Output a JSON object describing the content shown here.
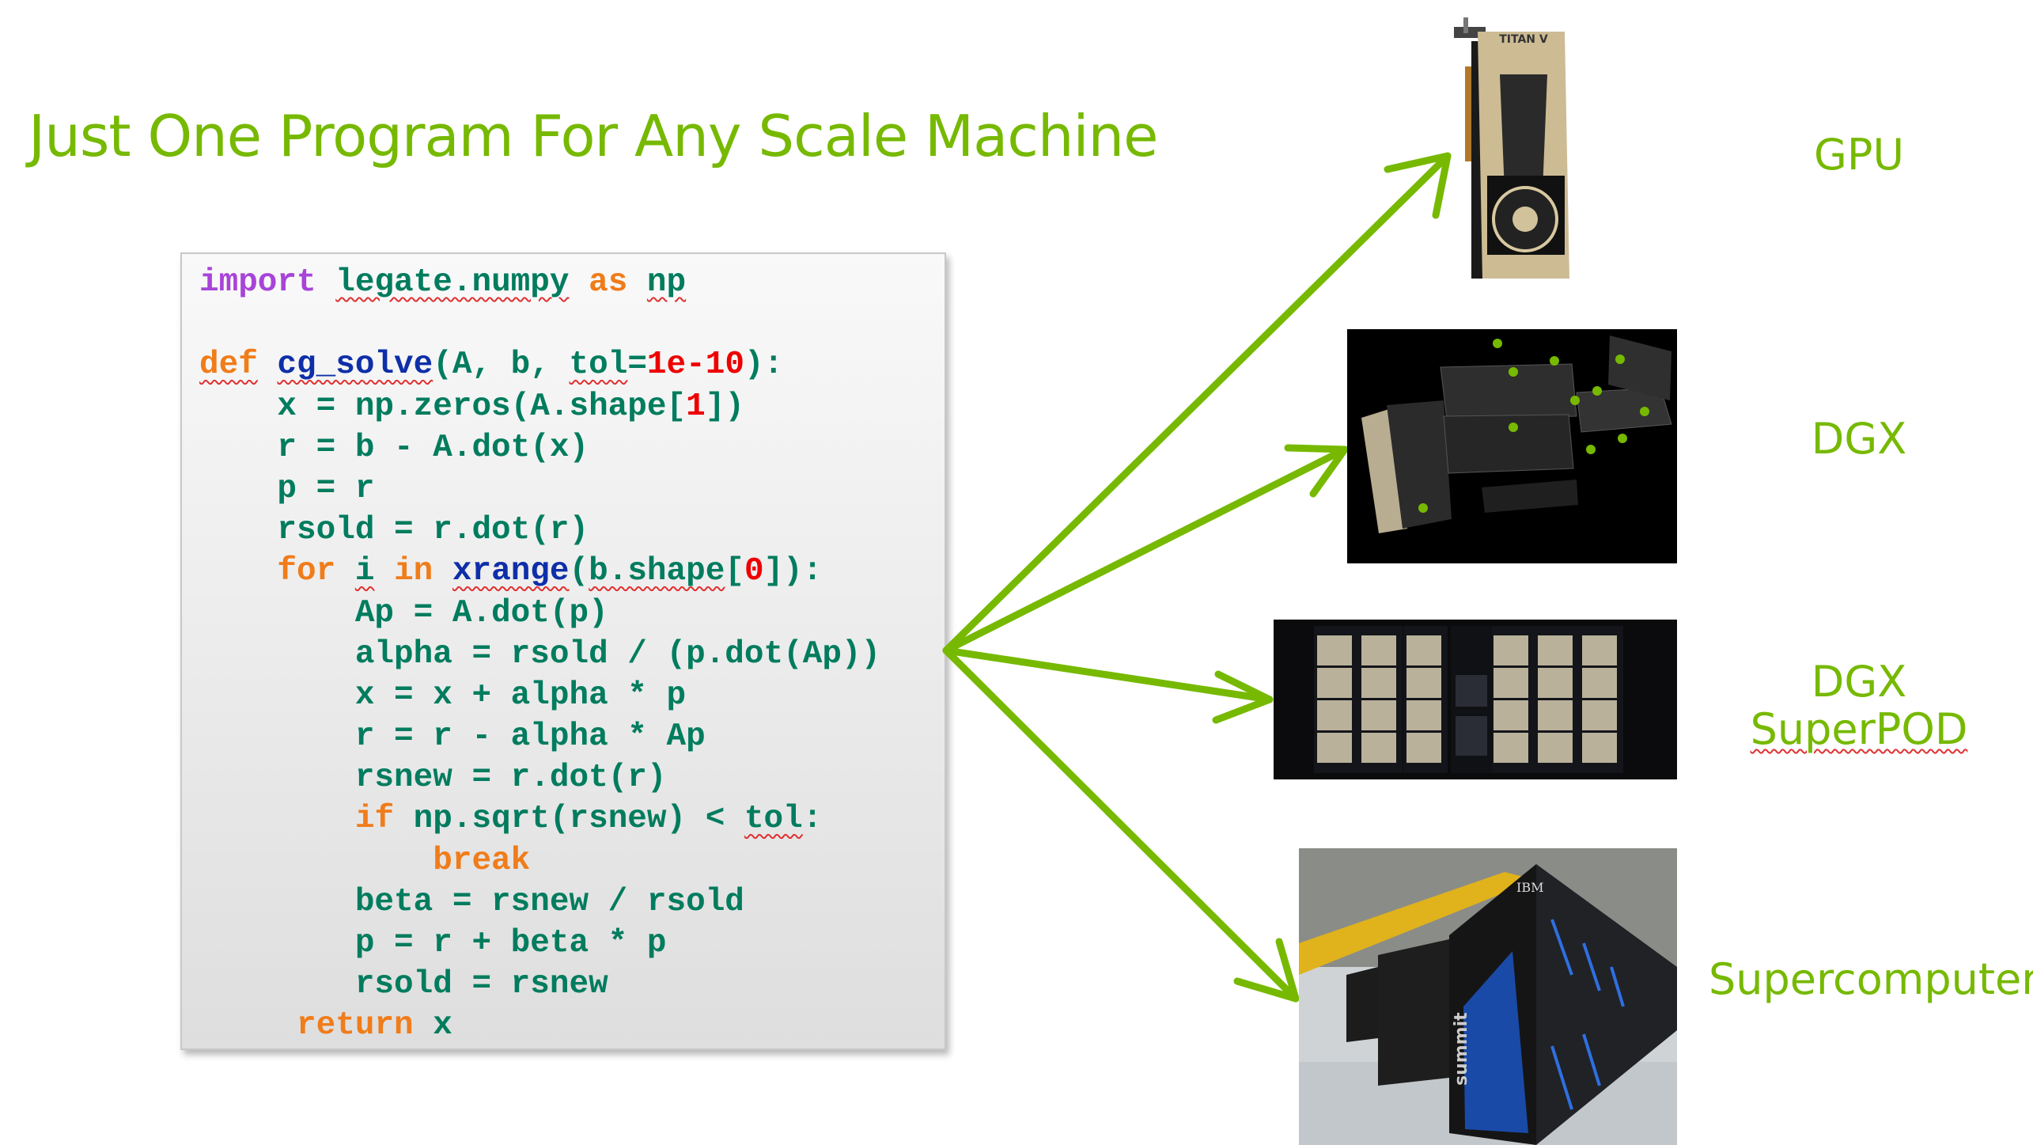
{
  "slide": {
    "title": "Just One Program For Any Scale Machine",
    "accent_color": "#76b900"
  },
  "code": {
    "language": "python",
    "lines": [
      [
        {
          "t": "import",
          "c": "kw-purple"
        },
        {
          "t": " "
        },
        {
          "t": "legate.numpy",
          "s": true
        },
        {
          "t": " "
        },
        {
          "t": "as",
          "c": "kw-orange"
        },
        {
          "t": " "
        },
        {
          "t": "np",
          "s": true
        }
      ],
      [],
      [
        {
          "t": "def",
          "c": "kw-orange",
          "s": true
        },
        {
          "t": " "
        },
        {
          "t": "cg_solve",
          "c": "fn-blue",
          "s": true
        },
        {
          "t": "(A, b, "
        },
        {
          "t": "tol",
          "s": true
        },
        {
          "t": "="
        },
        {
          "t": "1e-10",
          "c": "num-red"
        },
        {
          "t": "):"
        }
      ],
      [
        {
          "t": "    x = np.zeros(A.shape["
        },
        {
          "t": "1",
          "c": "num-red"
        },
        {
          "t": "])"
        }
      ],
      [
        {
          "t": "    r = b - A.dot(x)"
        }
      ],
      [
        {
          "t": "    p = r"
        }
      ],
      [
        {
          "t": "    rsold = r.dot(r)"
        }
      ],
      [
        {
          "t": "    "
        },
        {
          "t": "for",
          "c": "kw-orange"
        },
        {
          "t": " "
        },
        {
          "t": "i",
          "s": true
        },
        {
          "t": " "
        },
        {
          "t": "in",
          "c": "kw-orange"
        },
        {
          "t": " "
        },
        {
          "t": "xrange",
          "c": "fn-blue",
          "s": true
        },
        {
          "t": "("
        },
        {
          "t": "b.shape",
          "s": true
        },
        {
          "t": "["
        },
        {
          "t": "0",
          "c": "num-red"
        },
        {
          "t": "]):"
        }
      ],
      [
        {
          "t": "        Ap = A.dot(p)"
        }
      ],
      [
        {
          "t": "        alpha = rsold / (p.dot(Ap))"
        }
      ],
      [
        {
          "t": "        x = x + alpha * p"
        }
      ],
      [
        {
          "t": "        r = r - alpha * Ap"
        }
      ],
      [
        {
          "t": "        rsnew = r.dot(r)"
        }
      ],
      [
        {
          "t": "        "
        },
        {
          "t": "if",
          "c": "kw-orange"
        },
        {
          "t": " np.sqrt(rsnew) < "
        },
        {
          "t": "tol",
          "s": true
        },
        {
          "t": ":"
        }
      ],
      [
        {
          "t": "            "
        },
        {
          "t": "break",
          "c": "kw-orange"
        }
      ],
      [
        {
          "t": "        beta = rsnew / rsold"
        }
      ],
      [
        {
          "t": "        p = r + beta * p"
        }
      ],
      [
        {
          "t": "        rsold = rsnew"
        }
      ],
      [
        {
          "t": "     "
        },
        {
          "t": "return",
          "c": "kw-orange"
        },
        {
          "t": " x"
        }
      ]
    ]
  },
  "targets": [
    {
      "id": "gpu",
      "label_lines": [
        "GPU"
      ],
      "image_name": "titan-v-gpu-image",
      "image_caption": "TITAN V"
    },
    {
      "id": "dgx",
      "label_lines": [
        "DGX"
      ],
      "image_name": "dgx-exploded-view-image"
    },
    {
      "id": "superpod",
      "label_lines": [
        "DGX",
        "SuperPOD"
      ],
      "image_name": "dgx-superpod-racks-image"
    },
    {
      "id": "supercomputer",
      "label_lines": [
        "Supercomputer"
      ],
      "image_name": "summit-supercomputer-image",
      "image_caption_1": "IBM",
      "image_caption_2": "summit"
    }
  ]
}
